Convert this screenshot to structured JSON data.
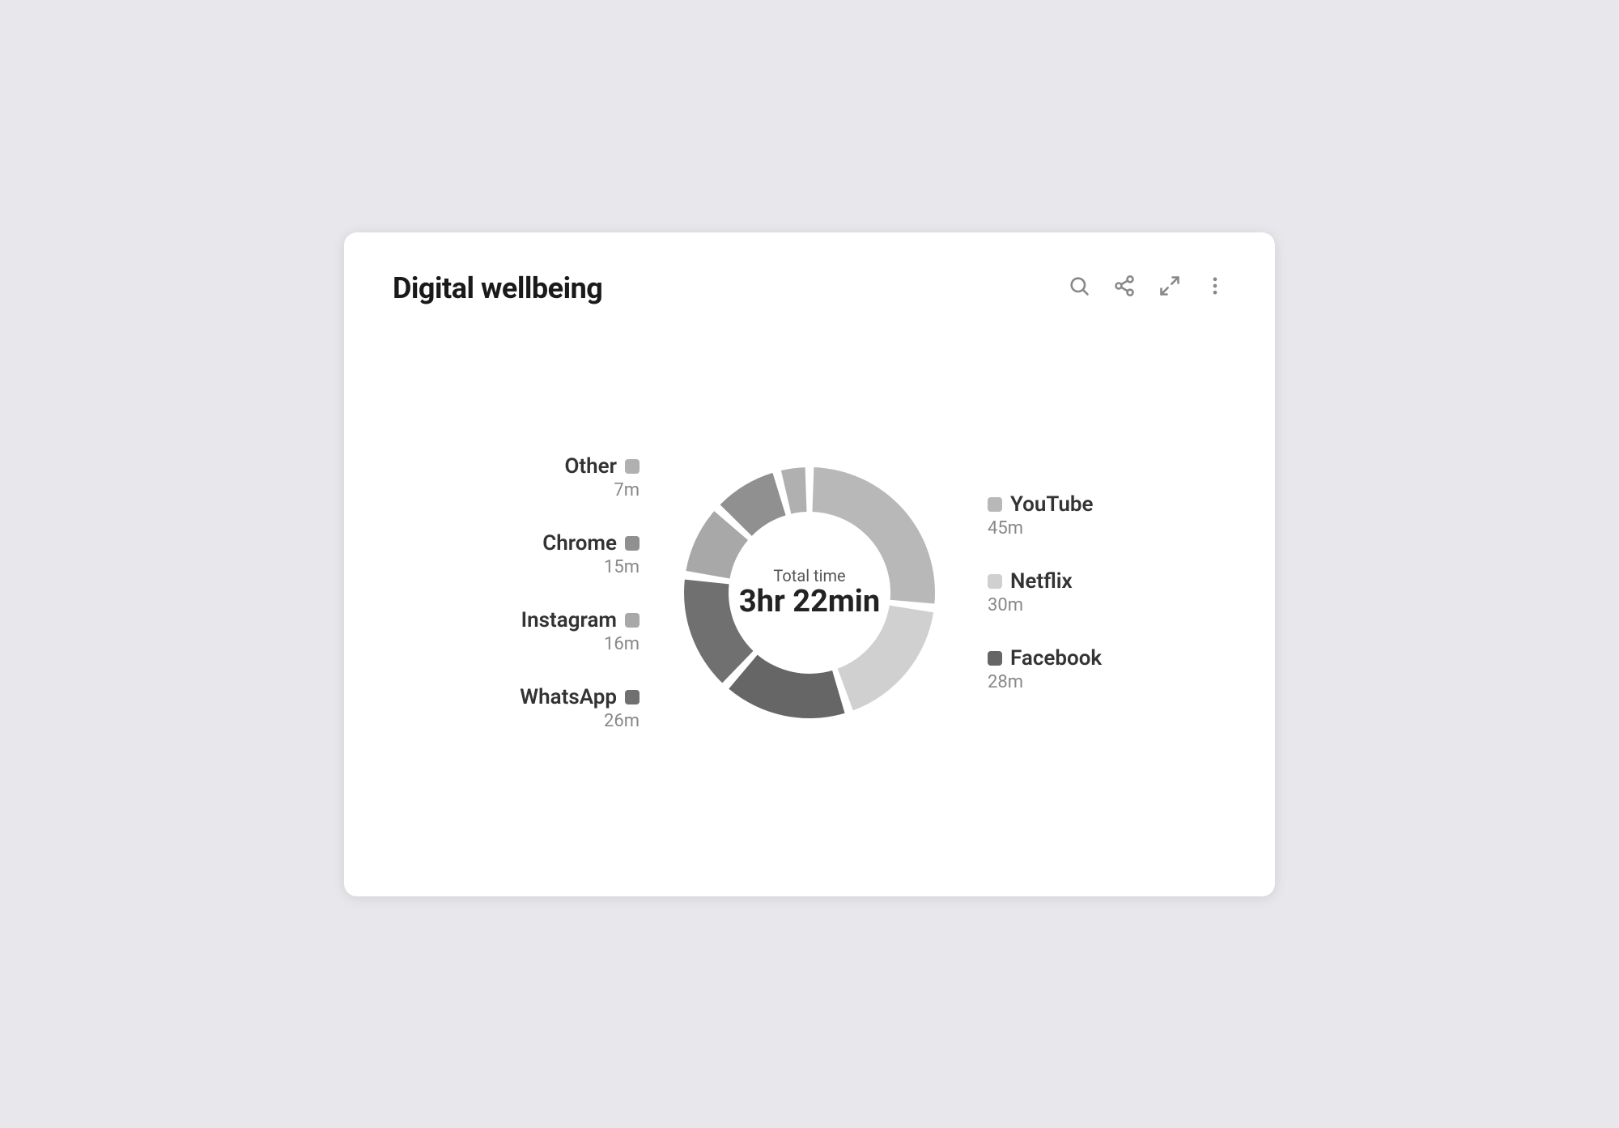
{
  "header": {
    "title": "Digital wellbeing",
    "icons": [
      "search",
      "share",
      "fullscreen",
      "more-vert"
    ]
  },
  "chart": {
    "center_label": "Total time",
    "center_value": "3hr 22min"
  },
  "left_legend": [
    {
      "name": "Other",
      "time": "7m",
      "color": "#b0b0b0"
    },
    {
      "name": "Chrome",
      "time": "15m",
      "color": "#909090"
    },
    {
      "name": "Instagram",
      "time": "16m",
      "color": "#a8a8a8"
    },
    {
      "name": "WhatsApp",
      "time": "26m",
      "color": "#707070"
    }
  ],
  "right_legend": [
    {
      "name": "YouTube",
      "time": "45m",
      "color": "#b8b8b8"
    },
    {
      "name": "Netflix",
      "time": "30m",
      "color": "#d0d0d0"
    },
    {
      "name": "Facebook",
      "time": "28m",
      "color": "#666666"
    }
  ],
  "segments": [
    {
      "app": "YouTube",
      "minutes": 45,
      "color": "#b8b8b8"
    },
    {
      "app": "Netflix",
      "minutes": 30,
      "color": "#d0d0d0"
    },
    {
      "app": "Facebook",
      "minutes": 28,
      "color": "#666666"
    },
    {
      "app": "WhatsApp",
      "minutes": 26,
      "color": "#707070"
    },
    {
      "app": "Instagram",
      "minutes": 16,
      "color": "#a8a8a8"
    },
    {
      "app": "Chrome",
      "minutes": 15,
      "color": "#909090"
    },
    {
      "app": "Other",
      "minutes": 7,
      "color": "#b0b0b0"
    }
  ]
}
